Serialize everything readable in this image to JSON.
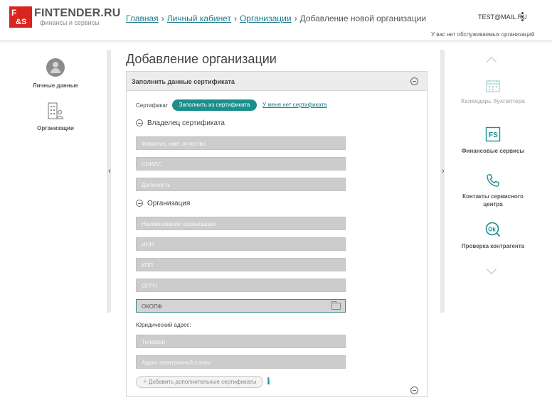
{
  "header": {
    "logo_mark": "F&S",
    "brand": "FINTENDER.RU",
    "brand_sub": "финансы и сервисы",
    "breadcrumb": [
      {
        "label": "Главная",
        "link": true
      },
      {
        "label": "Личный кабинет",
        "link": true
      },
      {
        "label": "Организации",
        "link": true
      },
      {
        "label": "Добавление новой организации",
        "link": false
      }
    ],
    "user_email": "TEST@MAIL.RU",
    "no_orgs_note": "У вас нет обслуживаемых организаций"
  },
  "left_nav": [
    {
      "label": "Личные данные",
      "icon": "user-avatar-icon"
    },
    {
      "label": "Организации",
      "icon": "organization-building-icon"
    }
  ],
  "main": {
    "title": "Добавление организации",
    "panel_title": "Заполнить данные сертификата",
    "cert_label": "Сертификат",
    "cert_fill_button": "Заполнить из сертификата",
    "cert_none_link": "У меня нет сертификата",
    "owner_section": "Владелец сертификата",
    "owner_fields": {
      "full_name": "Фамилия, имя, отчество",
      "snils": "СНИЛС",
      "position": "Должность"
    },
    "org_section": "Организация",
    "org_fields": {
      "name": "Наименование организации",
      "inn": "ИНН",
      "kpp": "КПП",
      "ogrn": "ОГРН",
      "okopf": "ОКОПФ"
    },
    "address_label": "Юридический адрес:",
    "contact_fields": {
      "phone": "Телефон",
      "email": "Адрес электронной почты"
    },
    "add_certs_button": "Добавить дополнительные сертификаты",
    "info_glyph": "i"
  },
  "right_nav": [
    {
      "label": "Календарь бухгалтера",
      "icon": "calendar-icon",
      "muted": true
    },
    {
      "label": "Финансовые сервисы",
      "icon": "finance-services-icon",
      "muted": false
    },
    {
      "label": "Контакты сервисного центра",
      "icon": "phone-icon",
      "muted": false
    },
    {
      "label": "Проверка контрагента",
      "icon": "ok-check-icon",
      "muted": false
    }
  ],
  "colors": {
    "brand_red": "#d9251d",
    "accent_teal": "#1b8f8e",
    "link_teal": "#1d7b8e",
    "field_gray": "#cccccc"
  }
}
